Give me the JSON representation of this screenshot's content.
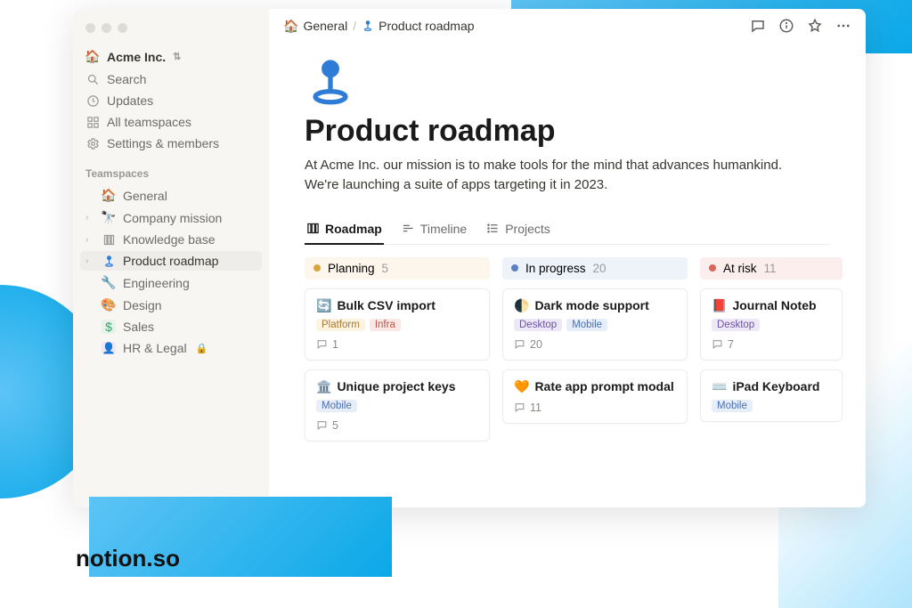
{
  "brand": "notion.so",
  "workspace": {
    "name": "Acme Inc."
  },
  "nav": {
    "search": "Search",
    "updates": "Updates",
    "teamspaces": "All teamspaces",
    "settings": "Settings & members"
  },
  "section_label": "Teamspaces",
  "sidebar": {
    "items": [
      {
        "label": "General"
      },
      {
        "label": "Company mission"
      },
      {
        "label": "Knowledge base"
      },
      {
        "label": "Product roadmap"
      },
      {
        "label": "Engineering"
      },
      {
        "label": "Design"
      },
      {
        "label": "Sales"
      },
      {
        "label": "HR & Legal"
      }
    ]
  },
  "breadcrumb": {
    "parent": "General",
    "current": "Product roadmap"
  },
  "page": {
    "title": "Product roadmap",
    "description": "At Acme Inc. our mission is to make tools for the mind that advances humankind. We're launching a suite of apps targeting it in 2023."
  },
  "tabs": [
    {
      "label": "Roadmap"
    },
    {
      "label": "Timeline"
    },
    {
      "label": "Projects"
    }
  ],
  "board": {
    "columns": [
      {
        "name": "Planning",
        "count": "5",
        "cards": [
          {
            "icon": "🔄",
            "title": "Bulk CSV import",
            "tags": [
              "Platform",
              "Infra"
            ],
            "comments": "1"
          },
          {
            "icon": "🏛️",
            "title": "Unique project keys",
            "tags": [
              "Mobile"
            ],
            "comments": "5"
          }
        ]
      },
      {
        "name": "In progress",
        "count": "20",
        "cards": [
          {
            "icon": "🌓",
            "title": "Dark mode support",
            "tags": [
              "Desktop",
              "Mobile"
            ],
            "comments": "20"
          },
          {
            "icon": "🧡",
            "title": "Rate app prompt modal",
            "tags": [],
            "comments": "11"
          }
        ]
      },
      {
        "name": "At risk",
        "count": "11",
        "cards": [
          {
            "icon": "📕",
            "title": "Journal Noteb",
            "tags": [
              "Desktop"
            ],
            "comments": "7"
          },
          {
            "icon": "⌨️",
            "title": "iPad Keyboard",
            "tags": [
              "Mobile"
            ],
            "comments": ""
          }
        ]
      }
    ]
  }
}
